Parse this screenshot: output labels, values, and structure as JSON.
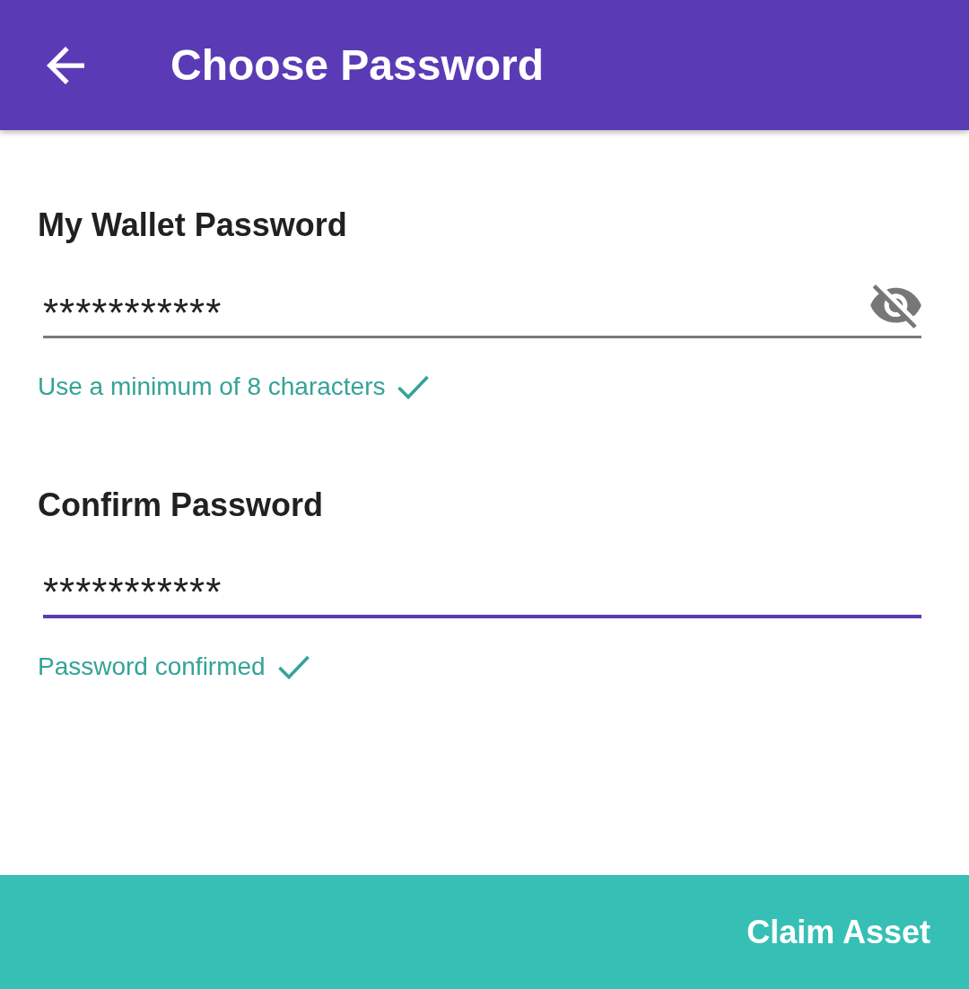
{
  "app_bar": {
    "title": "Choose Password"
  },
  "fields": [
    {
      "label": "My Wallet Password",
      "value": "***********",
      "focused": false,
      "toggle": {
        "visible": false
      },
      "helper": {
        "text": "Use a minimum of 8 characters",
        "valid": true
      }
    },
    {
      "label": "Confirm Password",
      "value": "***********",
      "focused": true,
      "helper": {
        "text": "Password confirmed",
        "valid": true
      }
    }
  ],
  "primary_button": {
    "label": "Claim Asset"
  }
}
